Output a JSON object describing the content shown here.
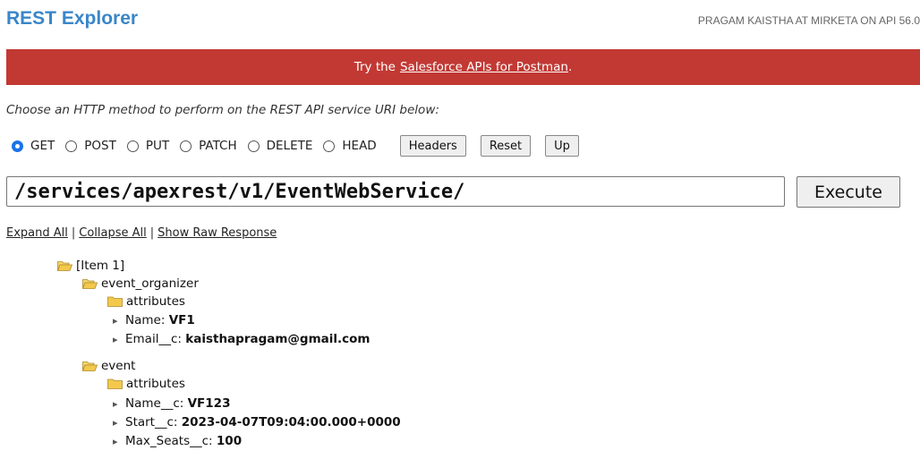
{
  "header": {
    "title": "REST Explorer",
    "user_info": "PRAGAM KAISTHA AT MIRKETA ON API 56.0"
  },
  "banner": {
    "prefix": "Try the",
    "link": "Salesforce APIs for Postman",
    "suffix": "."
  },
  "prompt": "Choose an HTTP method to perform on the REST API service URI below:",
  "methods": [
    {
      "label": "GET",
      "checked": true
    },
    {
      "label": "POST",
      "checked": false
    },
    {
      "label": "PUT",
      "checked": false
    },
    {
      "label": "PATCH",
      "checked": false
    },
    {
      "label": "DELETE",
      "checked": false
    },
    {
      "label": "HEAD",
      "checked": false
    }
  ],
  "buttons": {
    "headers": "Headers",
    "reset": "Reset",
    "up": "Up",
    "execute": "Execute"
  },
  "uri_value": "/services/apexrest/v1/EventWebService/",
  "links": {
    "expand": "Expand All",
    "collapse": "Collapse All",
    "raw": "Show Raw Response",
    "separator": "|"
  },
  "tree": {
    "item": "[Item 1]",
    "organizer": {
      "label": "event_organizer",
      "attributes": "attributes",
      "fields": [
        {
          "key": "Name:",
          "value": "VF1"
        },
        {
          "key": "Email__c:",
          "value": "kaisthapragam@gmail.com"
        }
      ]
    },
    "event": {
      "label": "event",
      "attributes": "attributes",
      "fields": [
        {
          "key": "Name__c:",
          "value": "VF123"
        },
        {
          "key": "Start__c:",
          "value": "2023-04-07T09:04:00.000+0000"
        },
        {
          "key": "Max_Seats__c:",
          "value": "100"
        }
      ]
    }
  },
  "colors": {
    "brand_blue": "#3a86c8",
    "banner_red": "#c23934",
    "folder_yellow": "#f2c94c"
  },
  "icons": {
    "open_folder": "open-folder-icon",
    "closed_folder": "closed-folder-icon",
    "bullet": "bullet-arrow-icon"
  }
}
